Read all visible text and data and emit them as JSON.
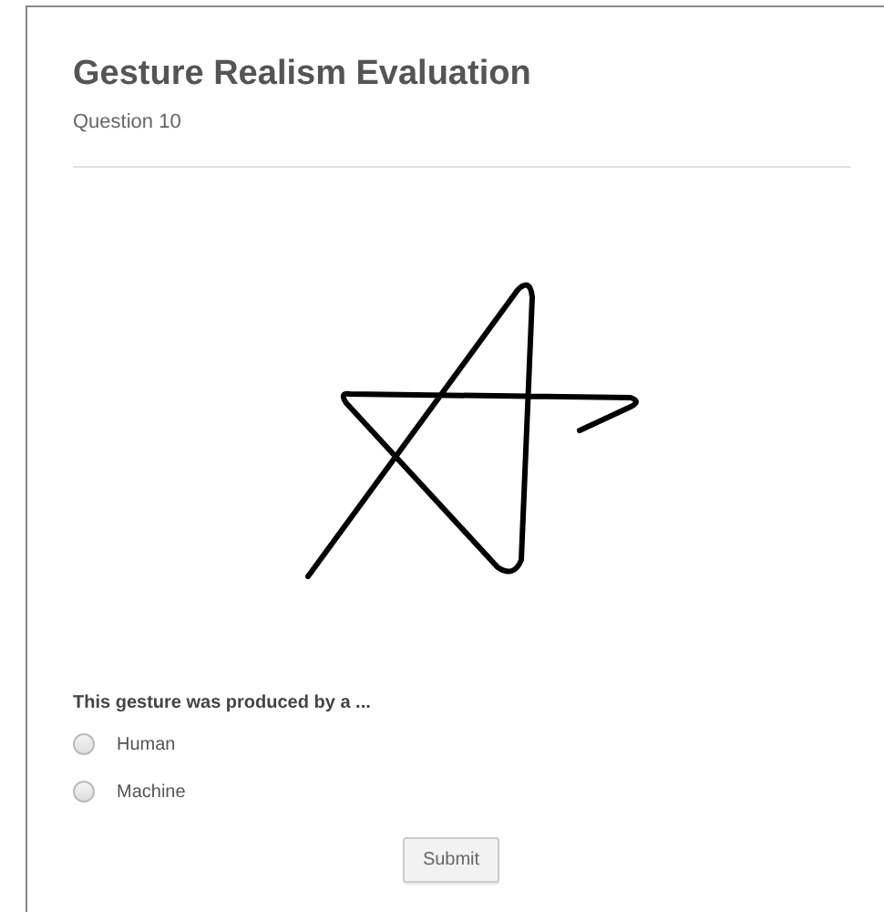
{
  "title": "Gesture Realism Evaluation",
  "subtitle": "Question 10",
  "question": "This gesture was produced by a ...",
  "options": [
    {
      "label": "Human",
      "selected": false
    },
    {
      "label": "Machine",
      "selected": false
    }
  ],
  "submit": "Submit"
}
